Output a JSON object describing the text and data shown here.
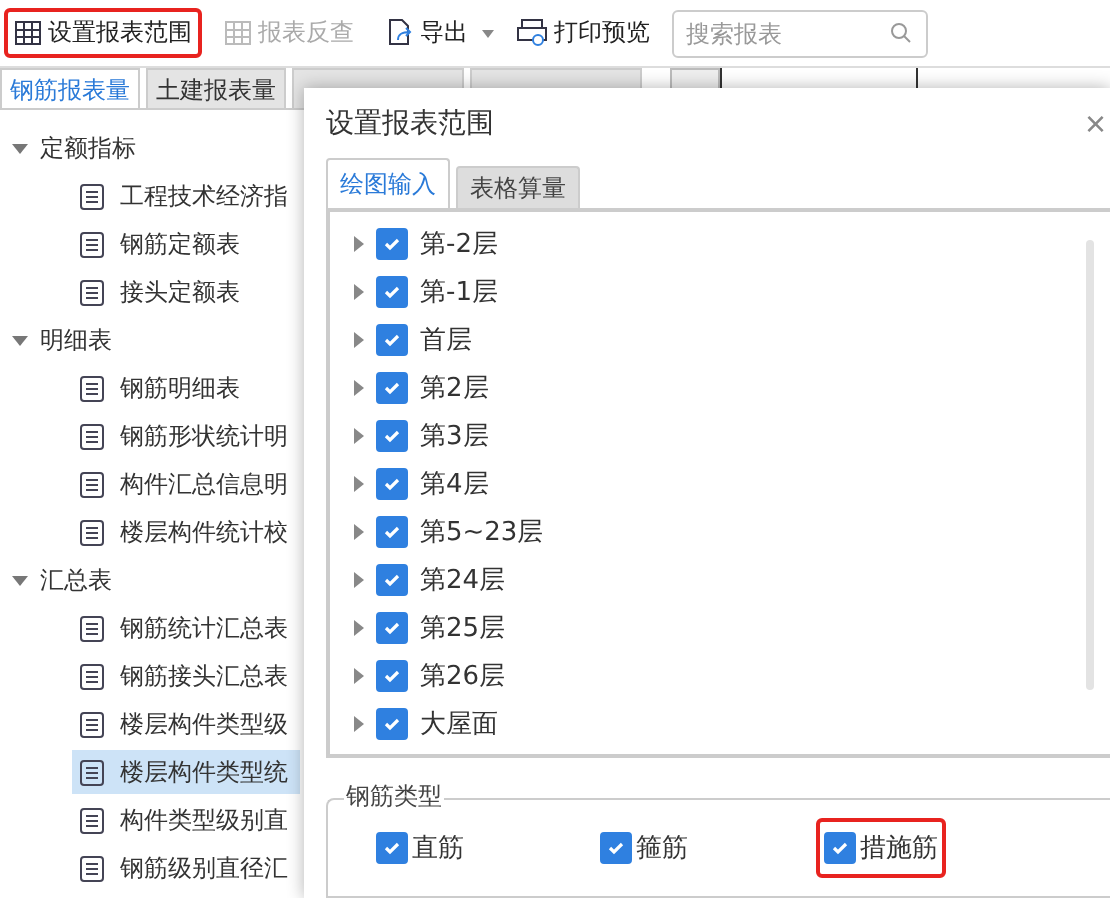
{
  "toolbar": {
    "items": [
      {
        "kind": "grid",
        "label": "设置报表范围",
        "disabled": false,
        "highlighted": true
      },
      {
        "kind": "grid",
        "label": "报表反查",
        "disabled": true,
        "highlighted": false
      },
      {
        "kind": "export",
        "label": "导出",
        "disabled": false,
        "highlighted": false
      },
      {
        "kind": "print",
        "label": "打印预览",
        "disabled": false,
        "highlighted": false
      }
    ],
    "search": {
      "placeholder": "搜索报表"
    }
  },
  "tabs": [
    {
      "label": "钢筋报表量",
      "selected": true
    },
    {
      "label": "土建报表量",
      "selected": false
    },
    {
      "selected": false
    },
    {
      "selected": false
    }
  ],
  "tree": [
    {
      "label": "定额指标",
      "expanded": true,
      "children": [
        {
          "label": "工程技术经济指",
          "selected": false
        },
        {
          "label": "钢筋定额表",
          "selected": false
        },
        {
          "label": "接头定额表",
          "selected": false
        }
      ]
    },
    {
      "label": "明细表",
      "expanded": true,
      "children": [
        {
          "label": "钢筋明细表",
          "selected": false
        },
        {
          "label": "钢筋形状统计明",
          "selected": false
        },
        {
          "label": "构件汇总信息明",
          "selected": false
        },
        {
          "label": "楼层构件统计校",
          "selected": false
        }
      ]
    },
    {
      "label": "汇总表",
      "expanded": true,
      "children": [
        {
          "label": "钢筋统计汇总表",
          "selected": false
        },
        {
          "label": "钢筋接头汇总表",
          "selected": false
        },
        {
          "label": "楼层构件类型级",
          "selected": false
        },
        {
          "label": "楼层构件类型统",
          "selected": true
        },
        {
          "label": "构件类型级别直",
          "selected": false
        },
        {
          "label": "钢筋级别直径汇",
          "selected": false
        }
      ]
    }
  ],
  "dialog": {
    "title": "设置报表范围",
    "close": "×",
    "tabs": [
      {
        "label": "绘图输入",
        "selected": true
      },
      {
        "label": "表格算量",
        "selected": false
      }
    ],
    "floors": [
      {
        "label": "第-2层",
        "checked": true
      },
      {
        "label": "第-1层",
        "checked": true
      },
      {
        "label": "首层",
        "checked": true
      },
      {
        "label": "第2层",
        "checked": true
      },
      {
        "label": "第3层",
        "checked": true
      },
      {
        "label": "第4层",
        "checked": true
      },
      {
        "label": "第5~23层",
        "checked": true
      },
      {
        "label": "第24层",
        "checked": true
      },
      {
        "label": "第25层",
        "checked": true
      },
      {
        "label": "第26层",
        "checked": true
      },
      {
        "label": "大屋面",
        "checked": true
      }
    ],
    "group": {
      "title": "钢筋类型",
      "options": [
        {
          "label": "直筋",
          "checked": true,
          "highlighted": false
        },
        {
          "label": "箍筋",
          "checked": true,
          "highlighted": false
        },
        {
          "label": "措施筋",
          "checked": true,
          "highlighted": true
        }
      ]
    }
  }
}
